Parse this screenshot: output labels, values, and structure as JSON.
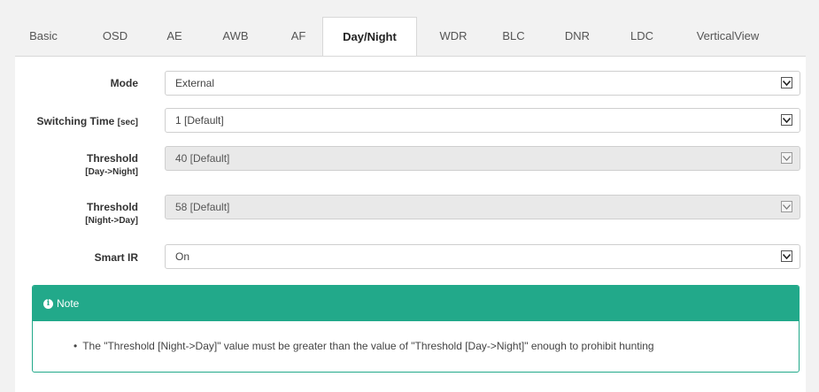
{
  "tabs": [
    {
      "label": "Basic",
      "active": false
    },
    {
      "label": "OSD",
      "active": false
    },
    {
      "label": "AE",
      "active": false
    },
    {
      "label": "AWB",
      "active": false
    },
    {
      "label": "AF",
      "active": false
    },
    {
      "label": "Day/Night",
      "active": true
    },
    {
      "label": "WDR",
      "active": false
    },
    {
      "label": "BLC",
      "active": false
    },
    {
      "label": "DNR",
      "active": false
    },
    {
      "label": "LDC",
      "active": false
    },
    {
      "label": "VerticalView",
      "active": false
    }
  ],
  "form": {
    "mode": {
      "label": "Mode",
      "value": "External",
      "enabled": true
    },
    "switching_time": {
      "label": "Switching Time",
      "unit": "[sec]",
      "value": "1  [Default]",
      "enabled": true
    },
    "threshold_day_night": {
      "label": "Threshold",
      "sub": "[Day->Night]",
      "value": "40 [Default]",
      "enabled": false
    },
    "threshold_night_day": {
      "label": "Threshold",
      "sub": "[Night->Day]",
      "value": "58 [Default]",
      "enabled": false
    },
    "smart_ir": {
      "label": "Smart IR",
      "value": "On",
      "enabled": true
    }
  },
  "note": {
    "title": "Note",
    "icon": "info-circle-icon",
    "bullet": "•",
    "text": "The \"Threshold [Night->Day]\" value must be greater than the value of \"Threshold [Day->Night]\" enough to prohibit hunting"
  },
  "colors": {
    "accent": "#22a98a",
    "background": "#f2f2f2",
    "disabled_field": "#e9e9e9"
  }
}
